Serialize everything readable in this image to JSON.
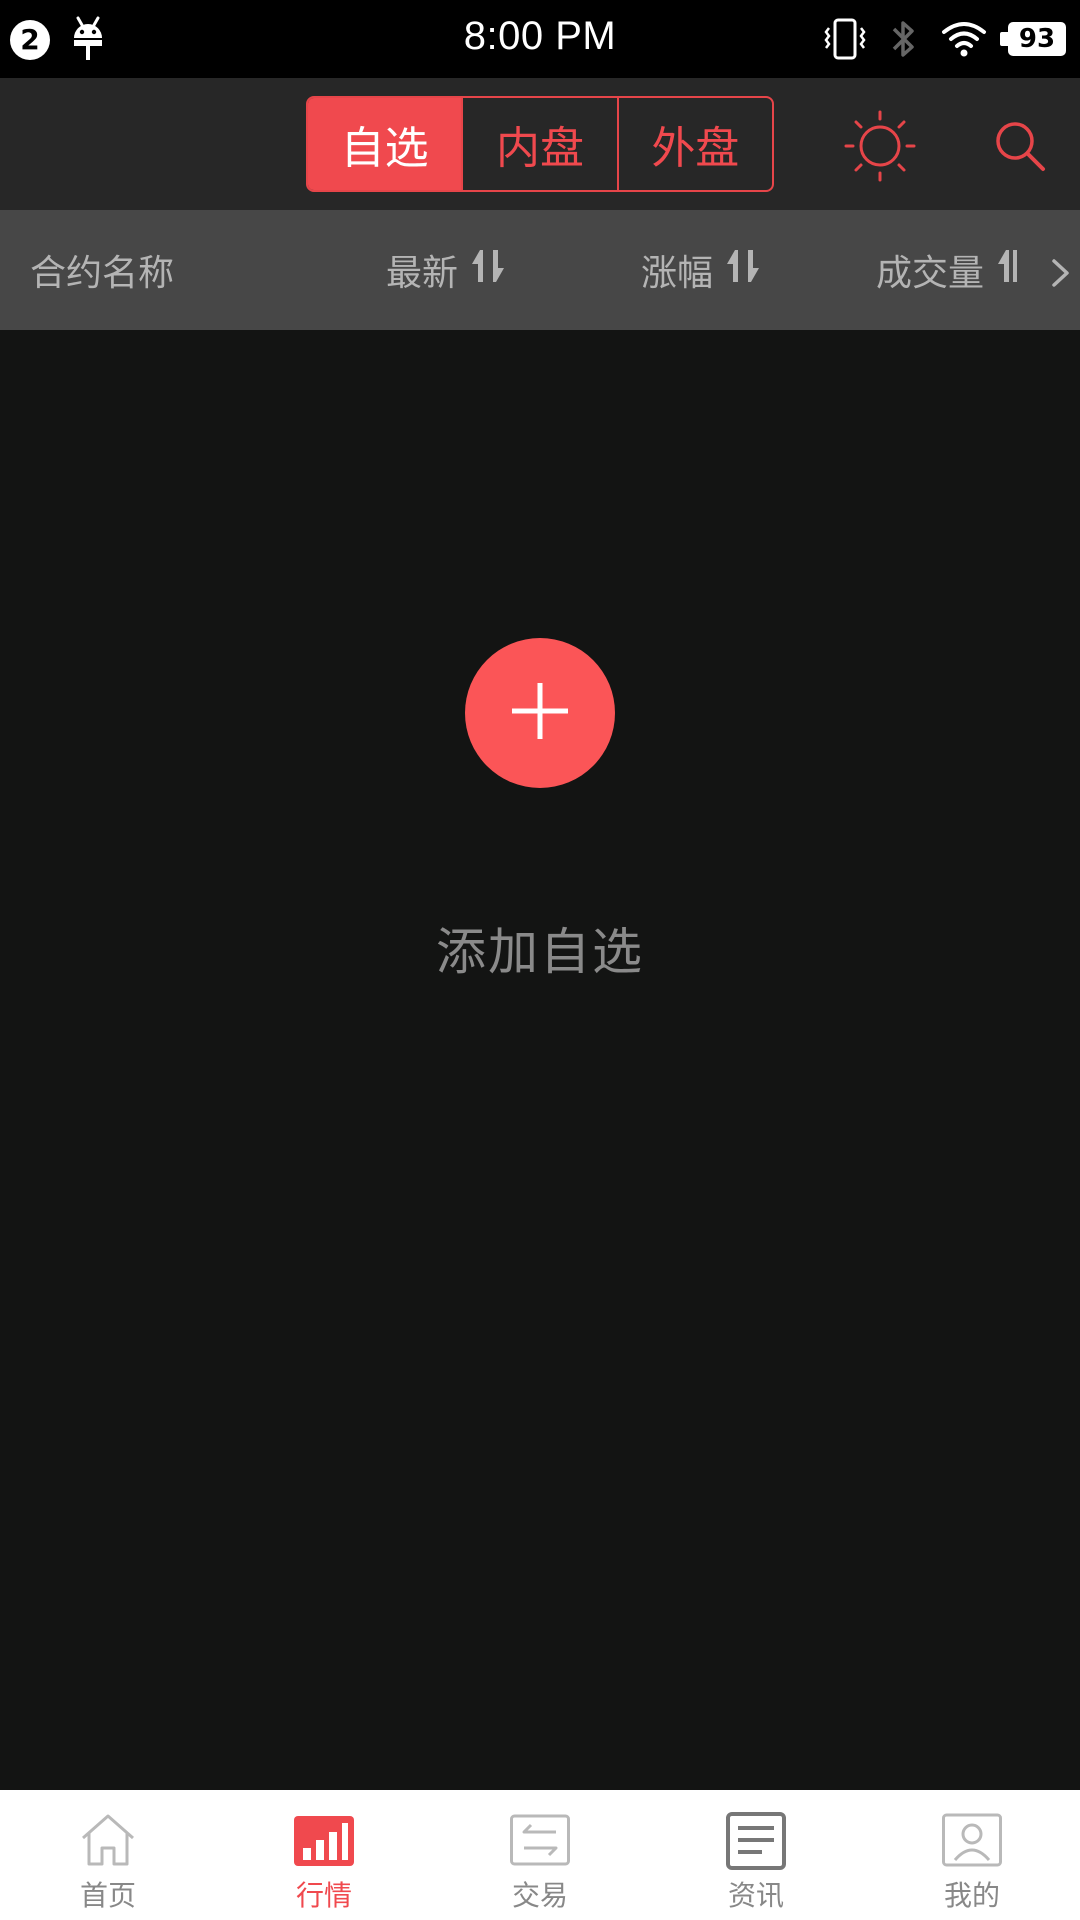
{
  "status_bar": {
    "notification_count": "2",
    "time": "8:00 PM",
    "battery": "93"
  },
  "toolbar": {
    "tabs": [
      {
        "label": "自选",
        "active": true
      },
      {
        "label": "内盘",
        "active": false
      },
      {
        "label": "外盘",
        "active": false
      }
    ],
    "icons": [
      "sun-icon",
      "search-icon"
    ],
    "accent_color": "#f0494e"
  },
  "columns": {
    "name": "合约名称",
    "latest": "最新",
    "change": "涨幅",
    "volume": "成交量"
  },
  "empty_state": {
    "add_label": "添加自选",
    "button_color": "#fb5557"
  },
  "bottom_nav": {
    "items": [
      {
        "label": "首页",
        "icon": "home-icon",
        "active": false
      },
      {
        "label": "行情",
        "icon": "market-chart-icon",
        "active": true
      },
      {
        "label": "交易",
        "icon": "trade-icon",
        "active": false
      },
      {
        "label": "资讯",
        "icon": "news-icon",
        "active": false
      },
      {
        "label": "我的",
        "icon": "profile-icon",
        "active": false
      }
    ]
  }
}
